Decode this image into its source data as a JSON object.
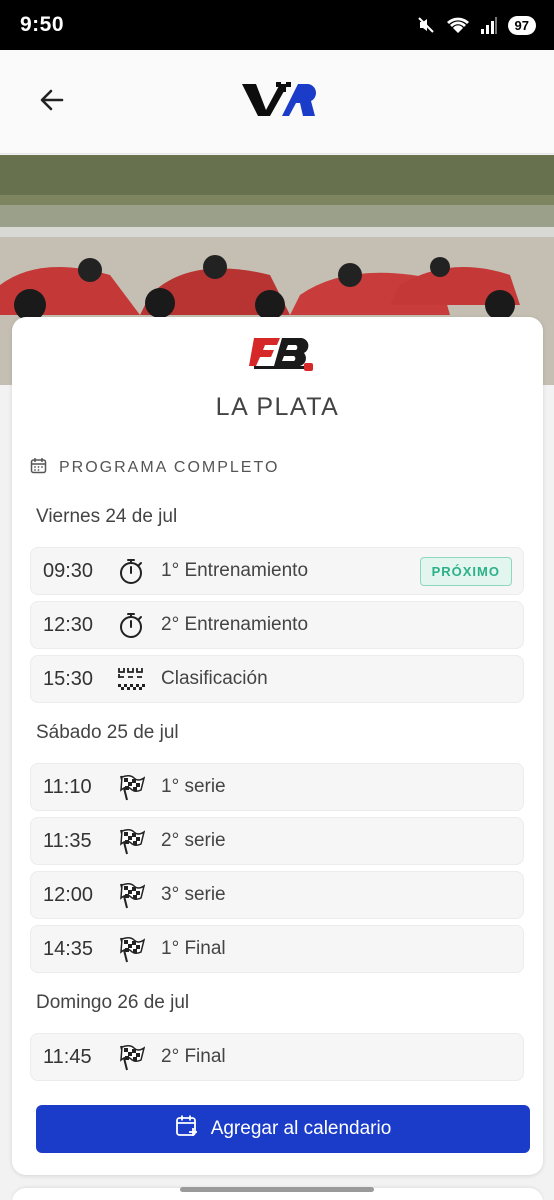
{
  "status_bar": {
    "time": "9:50",
    "battery": "97",
    "wifi_badge": "6"
  },
  "header": {
    "back_icon": "arrow-left-icon",
    "logo": "app-logo"
  },
  "event": {
    "series_logo_name": "Formula 3 Metropolitana",
    "city": "LA PLATA",
    "section_title": "PROGRAMA COMPLETO",
    "section_icon": "calendar-icon"
  },
  "days": [
    {
      "label": "Viernes 24 de jul",
      "sessions": [
        {
          "time": "09:30",
          "name": "1° Entrenamiento",
          "icon": "stopwatch-icon",
          "badge": "PRÓXIMO"
        },
        {
          "time": "12:30",
          "name": "2° Entrenamiento",
          "icon": "stopwatch-icon"
        },
        {
          "time": "15:30",
          "name": "Clasificación",
          "icon": "starting-grid-icon"
        }
      ]
    },
    {
      "label": "Sábado 25 de jul",
      "sessions": [
        {
          "time": "11:10",
          "name": "1° serie",
          "icon": "checkered-flag-icon"
        },
        {
          "time": "11:35",
          "name": "2° serie",
          "icon": "checkered-flag-icon"
        },
        {
          "time": "12:00",
          "name": "3° serie",
          "icon": "checkered-flag-icon"
        },
        {
          "time": "14:35",
          "name": "1° Final",
          "icon": "checkered-flag-icon"
        }
      ]
    },
    {
      "label": "Domingo 26 de jul",
      "sessions": [
        {
          "time": "11:45",
          "name": "2° Final",
          "icon": "checkered-flag-icon"
        }
      ]
    }
  ],
  "actions": {
    "add_calendar_label": "Agregar al calendario",
    "add_calendar_icon": "calendar-plus-icon"
  },
  "colors": {
    "primary_button": "#1a3cc8",
    "badge_text": "#2bb08a",
    "badge_bg": "#e2f6ef",
    "brand_red": "#d62828"
  }
}
